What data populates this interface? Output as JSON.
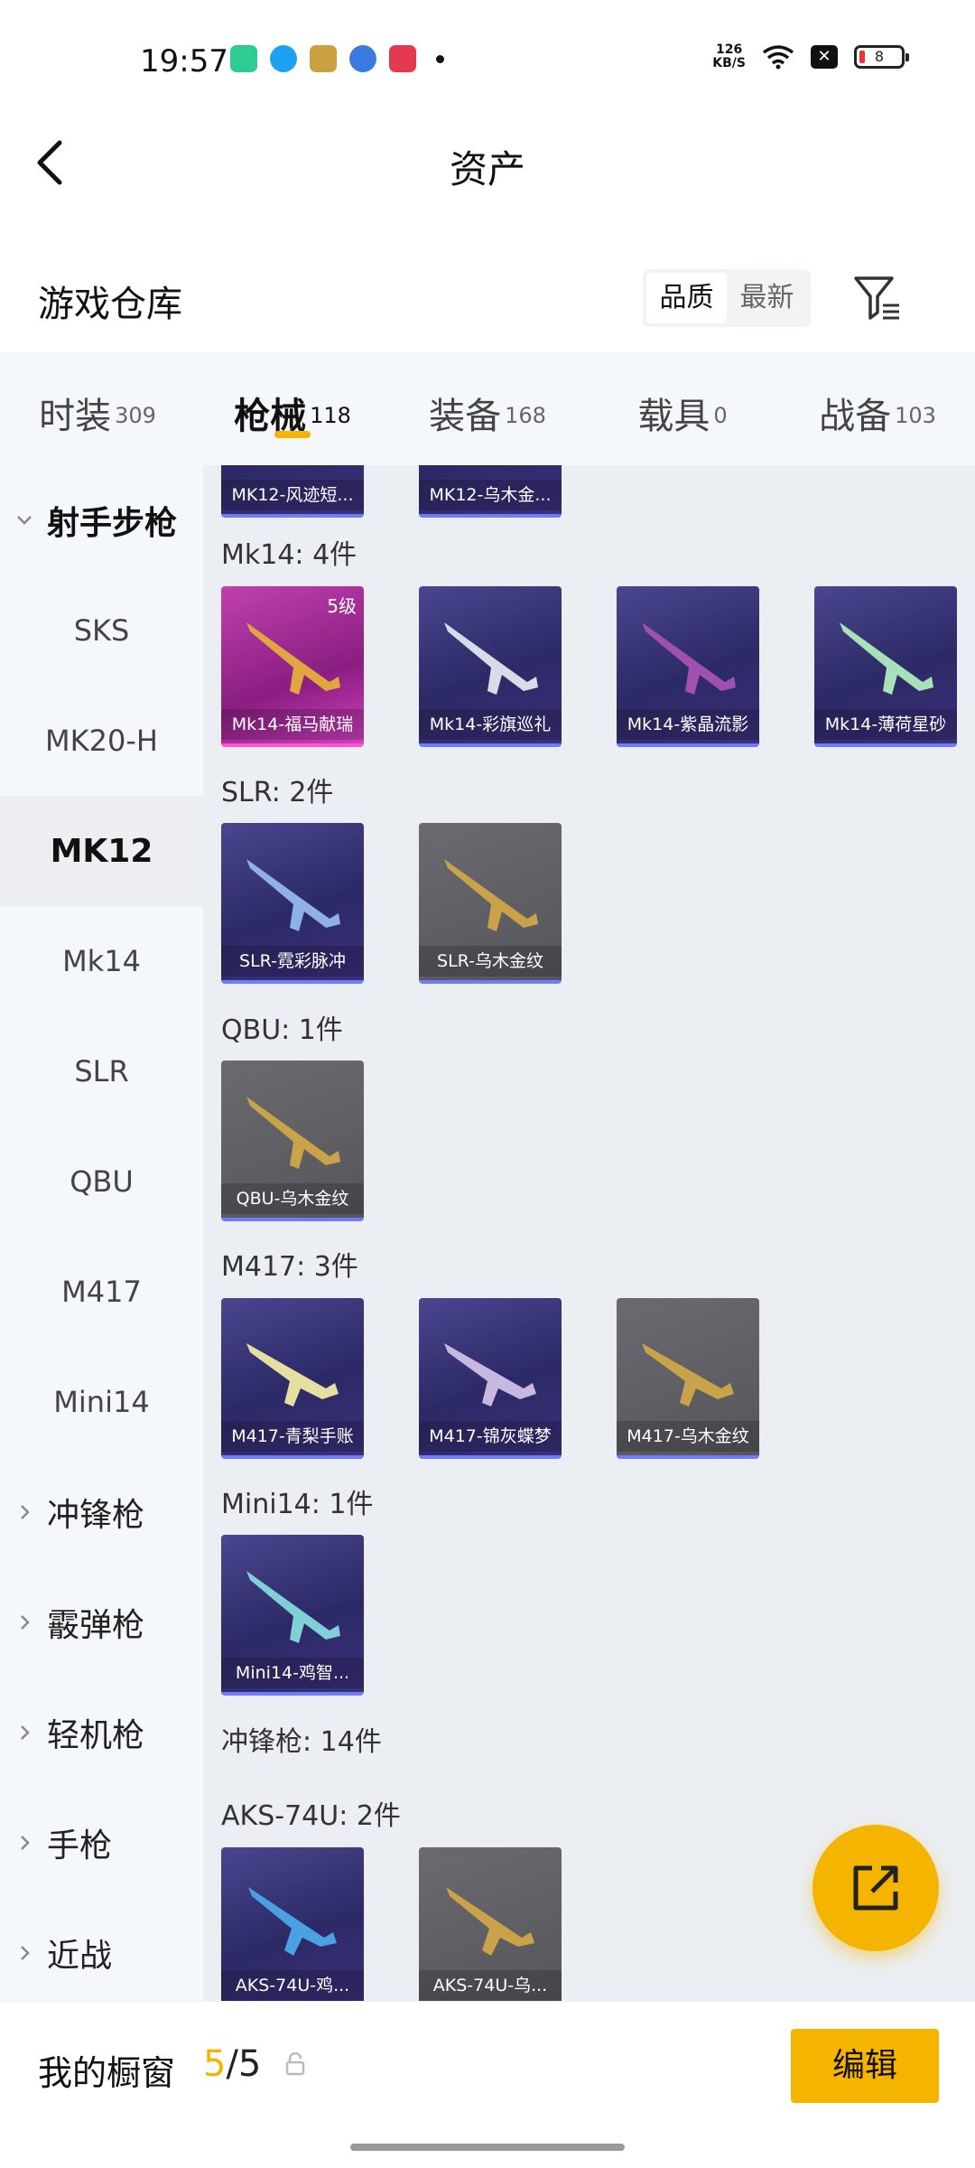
{
  "status_bar": {
    "time": "19:57",
    "speed_value": "126",
    "speed_unit": "KB/S",
    "battery": "8"
  },
  "header": {
    "title": "资产"
  },
  "section": {
    "title": "游戏仓库",
    "sort_options": [
      "品质",
      "最新"
    ],
    "active_sort": "品质"
  },
  "tabs": [
    {
      "label": "时装",
      "count": "309"
    },
    {
      "label": "枪械",
      "count": "118",
      "active": true
    },
    {
      "label": "装备",
      "count": "168"
    },
    {
      "label": "载具",
      "count": "0"
    },
    {
      "label": "战备",
      "count": "103"
    }
  ],
  "sidebar": {
    "open_group": "射手步枪",
    "sub_items": [
      "SKS",
      "MK20-H",
      "MK12",
      "Mk14",
      "SLR",
      "QBU",
      "M417",
      "Mini14"
    ],
    "active_item": "MK12",
    "groups": [
      "冲锋枪",
      "霰弹枪",
      "轻机枪",
      "手枪",
      "近战"
    ]
  },
  "content": {
    "top_partial": [
      "MK12-风迹短...",
      "MK12-乌木金..."
    ],
    "groups": [
      {
        "label": "Mk14: 4件",
        "items": [
          {
            "name": "Mk14-福马献瑞",
            "level": "5级",
            "rarity": "pink"
          },
          {
            "name": "Mk14-彩旗巡礼",
            "rarity": "purple"
          },
          {
            "name": "Mk14-紫晶流影",
            "rarity": "purple"
          },
          {
            "name": "Mk14-薄荷星砂",
            "rarity": "purple"
          }
        ]
      },
      {
        "label": "SLR: 2件",
        "items": [
          {
            "name": "SLR-霓彩脉冲",
            "rarity": "purple"
          },
          {
            "name": "SLR-乌木金纹",
            "rarity": "gray"
          }
        ]
      },
      {
        "label": "QBU: 1件",
        "items": [
          {
            "name": "QBU-乌木金纹",
            "rarity": "gray"
          }
        ]
      },
      {
        "label": "M417: 3件",
        "items": [
          {
            "name": "M417-青梨手账",
            "rarity": "purple"
          },
          {
            "name": "M417-锦灰蝶梦",
            "rarity": "purple"
          },
          {
            "name": "M417-乌木金纹",
            "rarity": "gray"
          }
        ]
      },
      {
        "label": "Mini14: 1件",
        "items": [
          {
            "name": "Mini14-鸡智...",
            "rarity": "purple"
          }
        ]
      }
    ],
    "category_label": "冲锋枪: 14件",
    "aks_group": {
      "label": "AKS-74U: 2件",
      "items": [
        {
          "name": "AKS-74U-鸡...",
          "rarity": "purple"
        },
        {
          "name": "AKS-74U-乌...",
          "rarity": "gray"
        }
      ]
    }
  },
  "bottom": {
    "showcase_label": "我的橱窗",
    "current": "5",
    "total": "/5",
    "edit_label": "编辑"
  },
  "colors": {
    "accent": "#f5b400",
    "sidebar_bg": "#f5f8fb",
    "content_bg": "#ebeef2"
  }
}
